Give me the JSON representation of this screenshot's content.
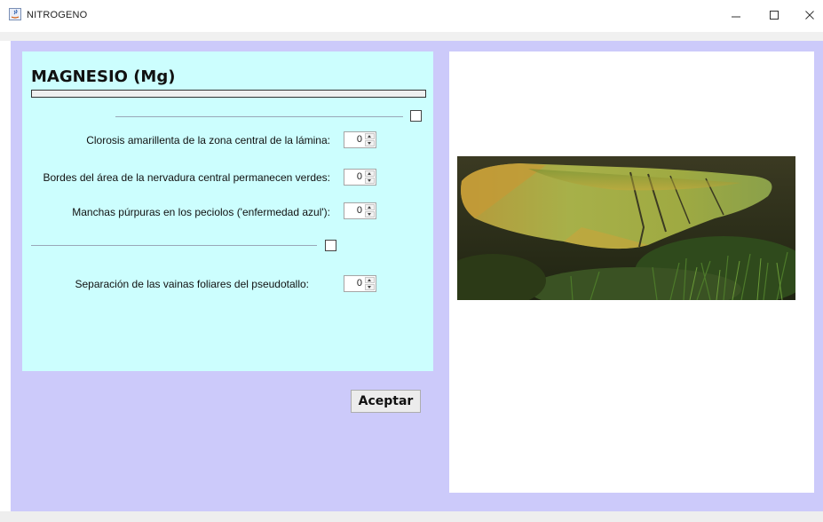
{
  "window": {
    "title": "NITROGENO"
  },
  "panel": {
    "title": "MAGNESIO (Mg)",
    "progress": 0.0,
    "rows": [
      {
        "label": "Clorosis amarillenta de la zona central de la lámina:",
        "value": "0"
      },
      {
        "label": "Bordes del área de la nervadura central permanecen verdes:",
        "value": "0"
      },
      {
        "label": "Manchas púrpuras en los peciolos ('enfermedad azul'):",
        "value": "0"
      },
      {
        "label": "Separación de las vainas foliares del pseudotallo:",
        "value": "0"
      }
    ]
  },
  "actions": {
    "accept_label": "Aceptar"
  },
  "image": {
    "subject": "banana-leaf-magnesium-deficiency-photo"
  },
  "colors": {
    "frame_bg": "#cccafa",
    "panel_bg": "#ccfefe"
  }
}
